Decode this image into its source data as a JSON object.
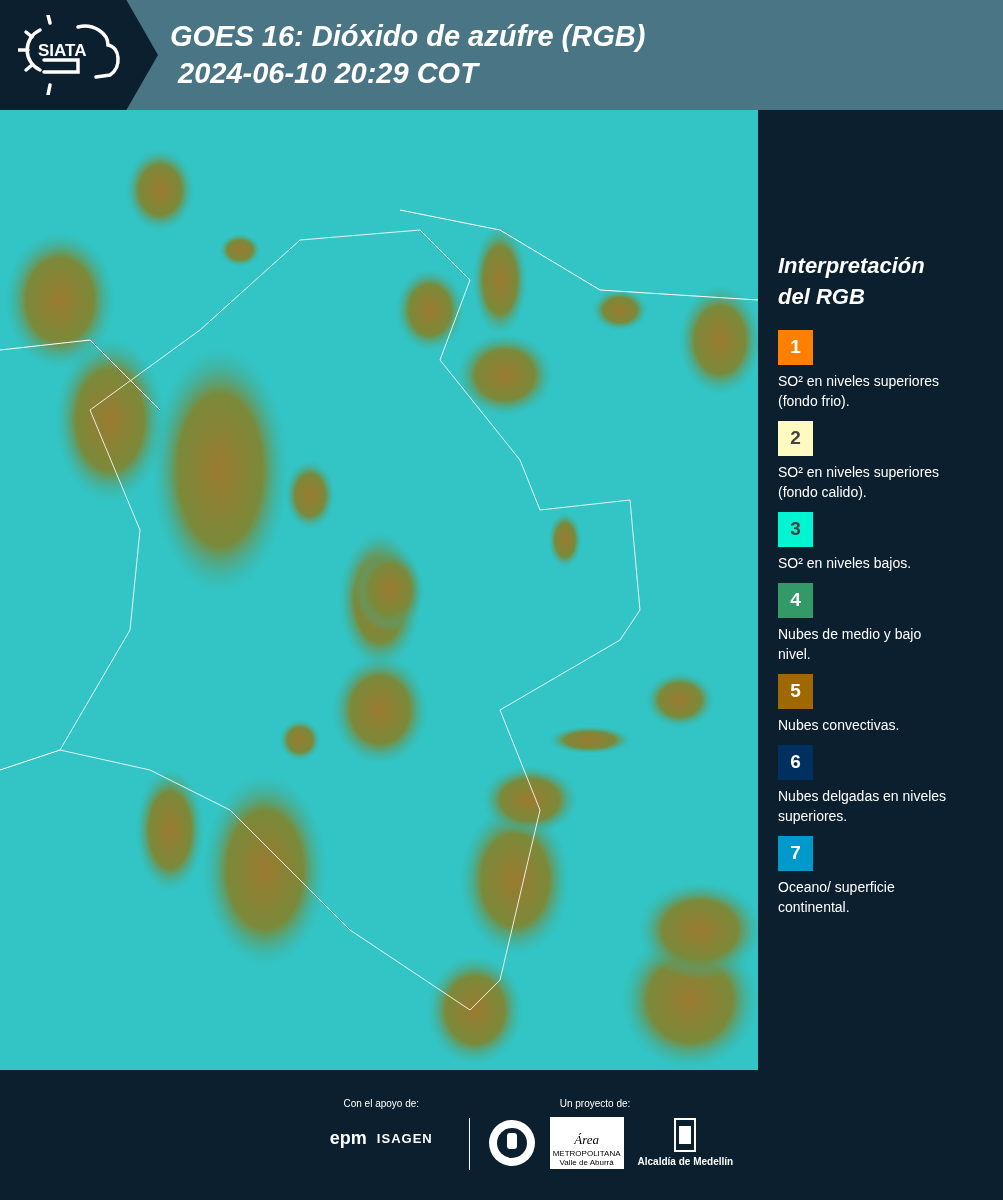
{
  "header": {
    "logo_text": "SIATA",
    "title": "GOES 16: Dióxido de azúfre (RGB)",
    "timestamp": "2024-06-10 20:29 COT"
  },
  "legend": {
    "title": "Interpretación del RGB",
    "items": [
      {
        "number": "1",
        "color": "#ff7f00",
        "description": "SO² en niveles superiores (fondo frio)."
      },
      {
        "number": "2",
        "color": "#fffac0",
        "description": "SO² en niveles superiores (fondo calido)."
      },
      {
        "number": "3",
        "color": "#00f5d0",
        "description": "SO² en niveles bajos."
      },
      {
        "number": "4",
        "color": "#339966",
        "description": "Nubes de medio y bajo nivel."
      },
      {
        "number": "5",
        "color": "#a06800",
        "description": "Nubes convectivas."
      },
      {
        "number": "6",
        "color": "#003060",
        "description": "Nubes delgadas en niveles superiores."
      },
      {
        "number": "7",
        "color": "#0099cc",
        "description": "Oceano/ superficie continental."
      }
    ]
  },
  "footer": {
    "support_label": "Con el apoyo de:",
    "support_logos": [
      "epm",
      "ISAGEN"
    ],
    "project_label": "Un proyecto de:",
    "area_logo": {
      "script": "Área",
      "lines": [
        "METROPOLITANA",
        "Valle de Aburrá"
      ]
    },
    "city_logo_text": "Alcaldía de Medellín"
  }
}
